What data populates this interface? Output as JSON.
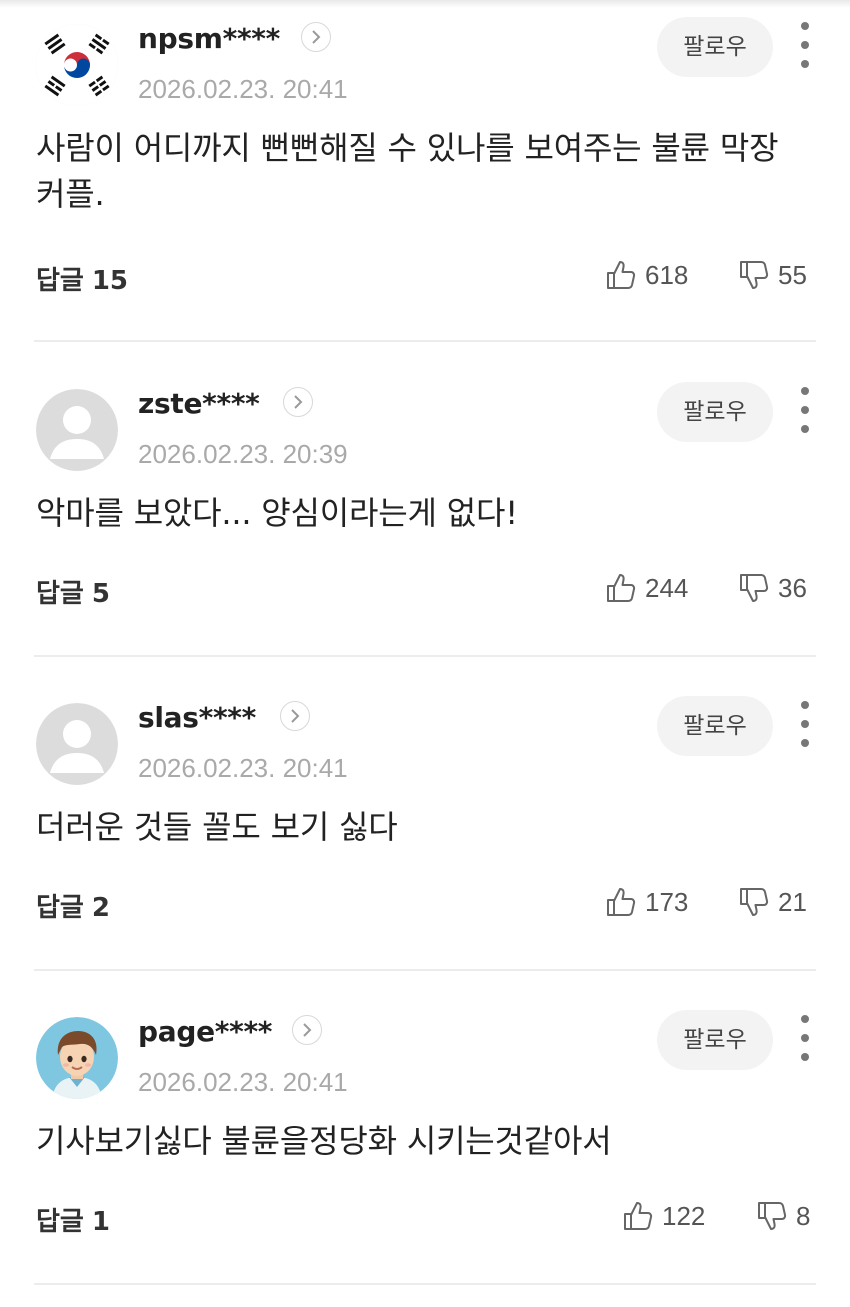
{
  "labels": {
    "follow": "팔로우",
    "replies": "답글"
  },
  "comments": [
    {
      "username": "npsm****",
      "timestamp": "2026.02.23. 20:41",
      "avatar": "korea-flag",
      "text": "사람이 어디까지 뻔뻔해질 수 있나를 보여주는 불륜 막장 커플.",
      "replies": "15",
      "likes": "618",
      "dislikes": "55"
    },
    {
      "username": "zste****",
      "timestamp": "2026.02.23. 20:39",
      "avatar": "default-user",
      "text": "악마를 보았다... 양심이라는게 없다!",
      "replies": "5",
      "likes": "244",
      "dislikes": "36"
    },
    {
      "username": "slas****",
      "timestamp": "2026.02.23. 20:41",
      "avatar": "default-user",
      "text": "더러운 것들 꼴도 보기 싫다",
      "replies": "2",
      "likes": "173",
      "dislikes": "21"
    },
    {
      "username": "page****",
      "timestamp": "2026.02.23. 20:41",
      "avatar": "cartoon-boy",
      "text": "기사보기싫다 불륜을정당화 시키는것같아서",
      "replies": "1",
      "likes": "122",
      "dislikes": "8"
    }
  ],
  "icons": {
    "like": "thumbs-up-icon",
    "dislike": "thumbs-down-icon",
    "more": "more-vertical-icon",
    "profile": "chevron-right-icon"
  },
  "colors": {
    "timestamp": "#a9a9a9",
    "follow_bg": "#f3f3f3",
    "divider": "#ececec",
    "text": "#222222"
  }
}
